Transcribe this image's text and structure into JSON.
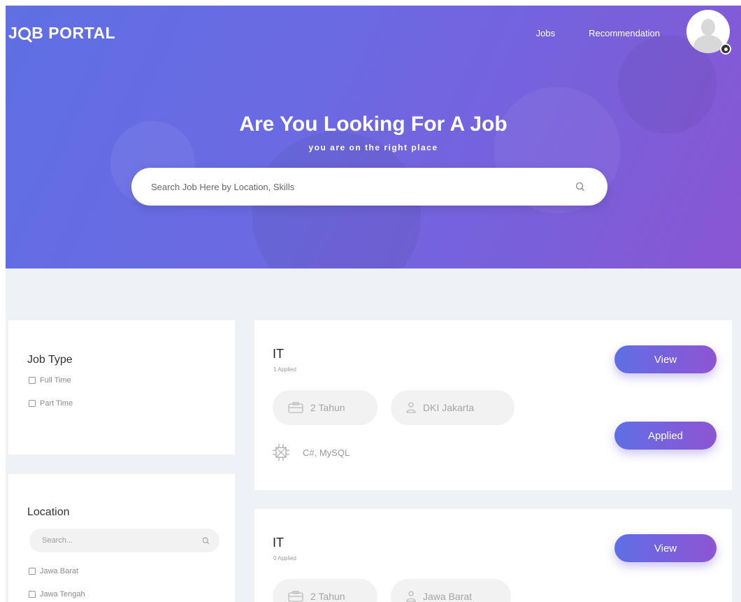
{
  "header": {
    "logo": {
      "prefix": "J",
      "suffix": "B PORTAL"
    },
    "nav": [
      {
        "label": "Jobs"
      },
      {
        "label": "Recommendation"
      }
    ]
  },
  "hero": {
    "title": "Are You Looking For A Job",
    "subtitle": "you are on the right place",
    "search_placeholder": "Search Job Here by Location, Skills"
  },
  "filters": {
    "job_type": {
      "title": "Job Type",
      "options": [
        "Full Time",
        "Part Time"
      ]
    },
    "location": {
      "title": "Location",
      "search_placeholder": "Search...",
      "options": [
        "Jawa Barat",
        "Jawa Tengah"
      ]
    }
  },
  "jobs": [
    {
      "title": "IT",
      "applied": "1 Applied",
      "experience": "2 Tahun",
      "location": "DKI Jakarta",
      "skills": "C#, MySQL",
      "view_label": "View",
      "applied_label": "Applied"
    },
    {
      "title": "IT",
      "applied": "0 Applied",
      "experience": "2 Tahun",
      "location": "Jawa Barat",
      "view_label": "View"
    }
  ],
  "colors": {
    "hero_start": "#5f6fe4",
    "hero_end": "#8a56d4",
    "page_bg": "#eef1f6"
  }
}
